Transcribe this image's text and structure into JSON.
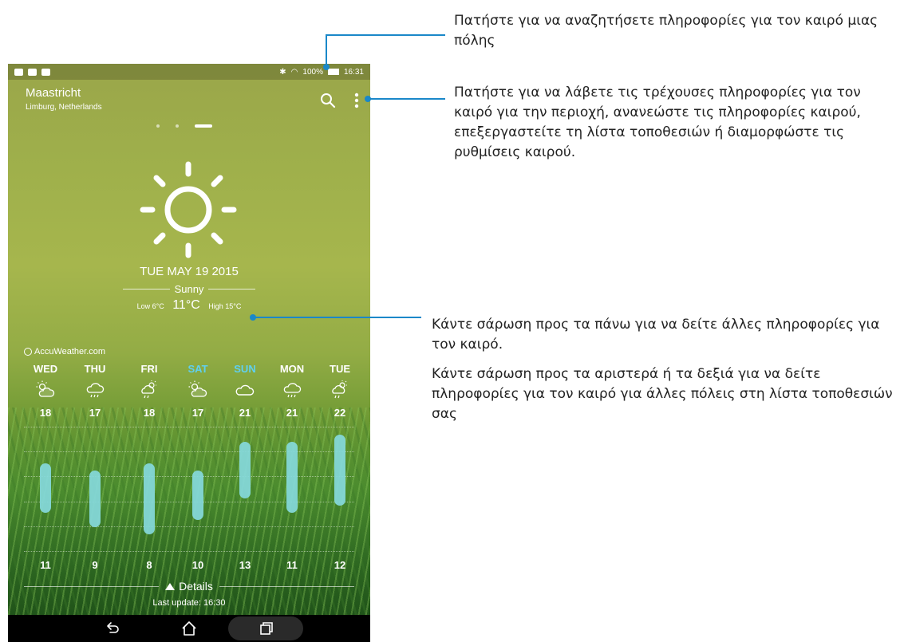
{
  "status_bar": {
    "battery": "100%",
    "time": "16:31"
  },
  "location": {
    "city": "Maastricht",
    "region": "Limburg, Netherlands"
  },
  "current": {
    "date": "TUE MAY 19 2015",
    "condition": "Sunny",
    "low_label": "Low 6°C",
    "temp": "11°C",
    "high_label": "High 15°C",
    "icon": "sun-icon"
  },
  "provider": "AccuWeather.com",
  "forecast": [
    {
      "day": "WED",
      "icon": "partly-cloudy-icon",
      "high": "18",
      "low": "11",
      "weekend": false
    },
    {
      "day": "THU",
      "icon": "rain-icon",
      "high": "17",
      "low": "9",
      "weekend": false
    },
    {
      "day": "FRI",
      "icon": "sun-rain-icon",
      "high": "18",
      "low": "8",
      "weekend": false
    },
    {
      "day": "SAT",
      "icon": "partly-cloudy-icon",
      "high": "17",
      "low": "10",
      "weekend": true
    },
    {
      "day": "SUN",
      "icon": "cloud-icon",
      "high": "21",
      "low": "13",
      "weekend": true
    },
    {
      "day": "MON",
      "icon": "rain-icon",
      "high": "21",
      "low": "11",
      "weekend": false
    },
    {
      "day": "TUE",
      "icon": "sun-rain-icon",
      "high": "22",
      "low": "12",
      "weekend": false
    }
  ],
  "details_label": "Details",
  "last_update": "Last update: 16:30",
  "callouts": {
    "search": "Πατήστε για να αναζητήσετε πληροφορίες για τον καιρό μιας πόλης",
    "menu": "Πατήστε για να λάβετε τις τρέχουσες πληροφορίες για τον καιρό για την περιοχή, ανανεώστε τις πληροφορίες καιρού, επεξεργαστείτε τη λίστα τοποθεσιών ή διαμορφώστε τις ρυθμίσεις καιρού.",
    "swipe_up": "Κάντε σάρωση προς τα πάνω για να δείτε άλλες πληροφορίες για τον καιρό.",
    "swipe_side": "Κάντε σάρωση προς τα αριστερά ή τα δεξιά για να δείτε πληροφορίες για τον καιρό για άλλες πόλεις στη λίστα τοποθεσιών σας"
  },
  "colors": {
    "accent": "#1a88c9",
    "weekend": "#5fd0f0",
    "bar": "#86d9dc"
  }
}
